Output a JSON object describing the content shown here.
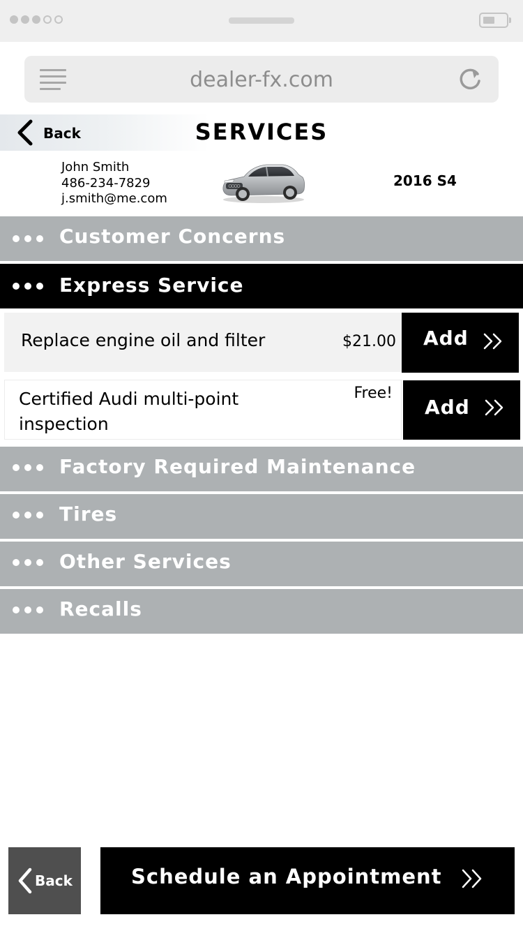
{
  "browser": {
    "url": "dealer-fx.com"
  },
  "header": {
    "back_label": "Back",
    "title": "SERVICES"
  },
  "customer": {
    "name": "John Smith",
    "phone": "486-234-7829",
    "email": "j.smith@me.com",
    "vehicle": "2016 S4"
  },
  "categories": [
    {
      "label": "Customer Concerns",
      "active": false
    },
    {
      "label": "Express Service",
      "active": true
    },
    {
      "label": "Factory Required Maintenance",
      "active": false
    },
    {
      "label": "Tires",
      "active": false
    },
    {
      "label": "Other Services",
      "active": false
    },
    {
      "label": "Recalls",
      "active": false
    }
  ],
  "services": [
    {
      "name": "Replace engine oil and filter",
      "price": "$21.00",
      "button": "Add"
    },
    {
      "name": "Certified Audi multi-point inspection",
      "price": "Free!",
      "button": "Add"
    }
  ],
  "footer": {
    "back_label": "Back",
    "schedule_label": "Schedule an Appointment"
  },
  "icons": {
    "menu": "menu-icon",
    "reload": "reload-icon",
    "back": "chevron-left-icon",
    "forward": "double-chevron-right-icon"
  },
  "colors": {
    "category_bg": "#adb1b3",
    "active_bg": "#000000",
    "item_bg": "#f2f2f2",
    "back_button_bg": "#4f4f4f"
  }
}
